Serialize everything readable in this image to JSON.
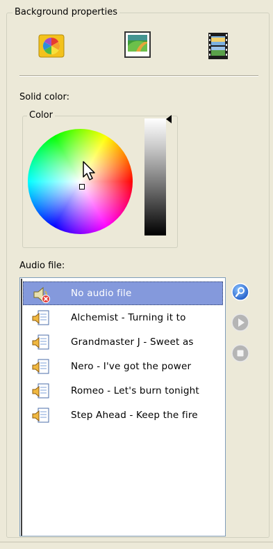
{
  "background_properties": {
    "title": "Background properties",
    "buttons": [
      {
        "icon": "color-palette-icon"
      },
      {
        "icon": "picture-icon"
      },
      {
        "icon": "film-icon"
      }
    ]
  },
  "solid_color": {
    "label": "Solid color:",
    "group_label": "Color"
  },
  "audio": {
    "label": "Audio file:",
    "items": [
      {
        "label": "No audio file",
        "icon": "no-audio-icon",
        "selected": true
      },
      {
        "label": "Alchemist - Turning it to",
        "icon": "audio-file-icon"
      },
      {
        "label": "Grandmaster J - Sweet as",
        "icon": "audio-file-icon"
      },
      {
        "label": "Nero -  I've got the power",
        "icon": "audio-file-icon"
      },
      {
        "label": "Romeo -  Let's burn tonight",
        "icon": "audio-file-icon"
      },
      {
        "label": "Step Ahead - Keep the fire",
        "icon": "audio-file-icon"
      }
    ],
    "controls": [
      {
        "icon": "browse-icon",
        "enabled": true
      },
      {
        "icon": "play-icon",
        "enabled": false
      },
      {
        "icon": "stop-icon",
        "enabled": false
      }
    ]
  },
  "colors": {
    "panel": "#ece9d8",
    "selection": "#8499dc",
    "accent": "#2563c9"
  }
}
